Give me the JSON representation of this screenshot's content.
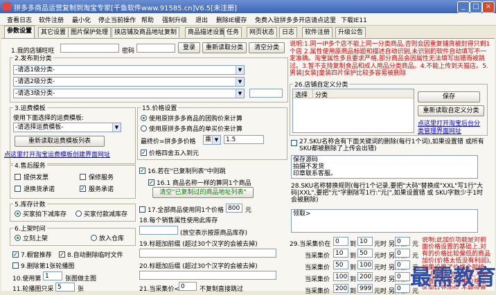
{
  "titlebar": {
    "title": "拼多多商品运营复制到淘宝专家[千鱼软件www.91585.cn]V6.5[未注册]",
    "minimize": "_",
    "maximize": "□",
    "close": "×"
  },
  "menu": [
    "查看日志",
    "软件注册",
    "最小化",
    "停止当前操作",
    "帮助",
    "强制升级",
    "退出",
    "删除IE缓存",
    "免费入驻拼多多开店请点这里",
    "下载IE11"
  ],
  "tabs": [
    "参数设置",
    "其它设置",
    "图片保护处理",
    "挟店铺及商品地址复制",
    "商品描述设置",
    "任务",
    "网页状态",
    "日志",
    "软件注册",
    "升级公告"
  ],
  "s1": {
    "label": "1.我的店铺旺旺",
    "pwd_label": "密码",
    "login": "登录",
    "reload": "重新读取分类",
    "clear": "清空分类"
  },
  "s2": {
    "title": "2.发布到分类",
    "opt1": "-请选1级分类-",
    "opt2": "-请选2级分类-",
    "opt3": "-请选3级分类-"
  },
  "s3": {
    "title": "3.运费模板",
    "use_label": "使用下面选择的运费模板:",
    "opt": "-请选择运费模板-",
    "reload": "重新读取运费模板列表",
    "link": "点这里打开淘宝运费模板创建界面网址"
  },
  "s4": {
    "title": "4.售后服务",
    "invoice": "提供发票",
    "warranty": "保修服务",
    "return": "退换货承诺",
    "service": "服务承诺"
  },
  "s5": {
    "title": "5.库存计数",
    "opt1": "买家拍下减库存",
    "opt2": "买家付款减库存"
  },
  "s6": {
    "title": "6.上架时间",
    "opt1": "立刻上架",
    "opt2": "放入仓库"
  },
  "s7": {
    "label": "7.橱窗推荐",
    "s8": "8.自动删除临时文件"
  },
  "s9": {
    "label": "9.删除第1张轮播图"
  },
  "s10": {
    "pre": "10.使用第",
    "value": "1",
    "post": "张图做主图"
  },
  "s11": {
    "pre": "11.轮播图只采",
    "value": "5",
    "post": "张"
  },
  "price": {
    "title": "15.价格设置",
    "opt1": "使用原拼多多商品的团购价来计算",
    "opt2": "使用原拼多多商品的单买价来计算",
    "final_label": "最终价=拼多多价格",
    "op": "乘",
    "factor": "1.5",
    "round": "价格四舍五入到元"
  },
  "s16": {
    "label": "16.若在\"已复制列表\"中则跳",
    "sub": "16.1 商品名称一样的算同1个商品",
    "clear": "清空\"已复制过的商品地址列表\""
  },
  "s17": {
    "pre": "17.全部商品使用同1个价格",
    "value": "800",
    "post": "元"
  },
  "s18": {
    "label": "18.每个销售属性使用此库存",
    "note": "(放空表示按原商品库存)"
  },
  "s19": {
    "label": "19.标题加前缀 (超过30个汉字的会被去掉)"
  },
  "s20": {
    "label": "20.标题加后缀 (超过30个汉字的会被去掉)"
  },
  "s21": {
    "label": "21.当采集价<=",
    "value": "0",
    "post": "不复制直接跳过"
  },
  "notice": "说明:1.同一IP多个店不能上同一分类商品,否则会因重复铺货被封得只剩1个店 2.属性使用原商品标题和描述自动识别,未识别的软件自动填写不一定准确。淘宝属性多且要求严格,部分商品会因属性无法填写出错而被跳过。3.暂不支持复制食品和成人用品分类商品。4.不能上传到天猫店。5.男装|女装|童装四片保护比较多容易被删除",
  "s26": {
    "title": "26.店铺自定义分类",
    "col1": "选择",
    "col2": "分类",
    "save": "保存",
    "reload": "重新读取自定义分类",
    "link1": "点这里打开淘宝后台分",
    "link2": "类管理界面网址"
  },
  "s27": {
    "label": "27.SKU名称含有下面关键词的删除(每行1个词),如果设置错 或所有SKU都被删除了上传会出错)",
    "text": "保存源码\n拍摄不发货\n印章联系客服。"
  },
  "s28": {
    "label": "28.SKU名称替换规则(每行1个记录,要把\"大码\"替换成\"XXL\"写1行\"大码|XXL\",要把\"元\"字删除写1行:\"元|\",如果设置错 或 SKU字数少于1时会被删除)",
    "text": "领取>"
  },
  "s29": {
    "title": "29.当采集价在",
    "rows": [
      {
        "a": "0",
        "b": "10",
        "c": "0"
      },
      {
        "a": "10",
        "b": "50",
        "c": "0"
      },
      {
        "a": "50",
        "b": "100",
        "c": "0"
      },
      {
        "a": "100",
        "b": "200",
        "c": "0"
      },
      {
        "a": "200",
        "b": "9999",
        "c": "0"
      }
    ],
    "t1": "当采集价",
    "t2": "到",
    "t3": "元时 另外加:",
    "t4": "元",
    "note": "说明:此加价功能是对前面价格设置的基础上,对有的价格比较偏低的商品加价(价格太低没有利润),如果设置了价格全部统一,则这个加价无效,不能设置为负数,如果价格在区间以外加价,不能设置为负数"
  },
  "watermark": "最需教育",
  "colors": {
    "titlebar": "#3a63b6",
    "notice": "#e00000",
    "link": "#0000ee",
    "clear_btn_text": "#008000"
  }
}
